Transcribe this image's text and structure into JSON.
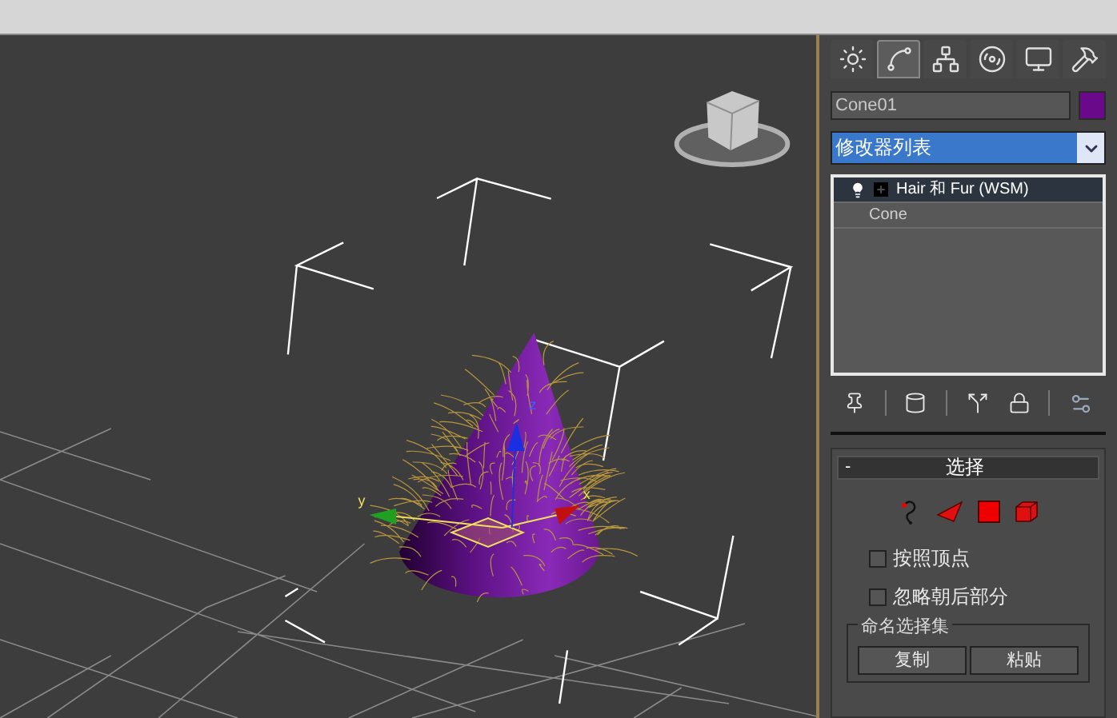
{
  "viewport": {
    "axis_labels": [
      {
        "kind": "x",
        "text": "x"
      },
      {
        "kind": "y",
        "text": "y"
      },
      {
        "kind": "z",
        "text": "z"
      }
    ]
  },
  "command_tabs": [
    {
      "kind": "create",
      "selected": false
    },
    {
      "kind": "modify",
      "selected": true
    },
    {
      "kind": "hierarchy",
      "selected": false
    },
    {
      "kind": "motion",
      "selected": false
    },
    {
      "kind": "display",
      "selected": false
    },
    {
      "kind": "utilities",
      "selected": false
    }
  ],
  "object_name": "Cone01",
  "modifier_list": {
    "value": "修改器列表"
  },
  "modifier_stack": [
    {
      "kind": "modifier",
      "label": "Hair 和 Fur (WSM)",
      "selected": true
    },
    {
      "kind": "base",
      "label": "Cone",
      "selected": false
    }
  ],
  "selection_rollout": {
    "collapse": "-",
    "title": "选择",
    "checkboxes": [
      {
        "label": "按照顶点",
        "checked": false
      },
      {
        "label": "忽略朝后部分",
        "checked": false
      }
    ],
    "named_selection": {
      "title": "命名选择集",
      "buttons": [
        "复制",
        "粘贴"
      ]
    }
  }
}
